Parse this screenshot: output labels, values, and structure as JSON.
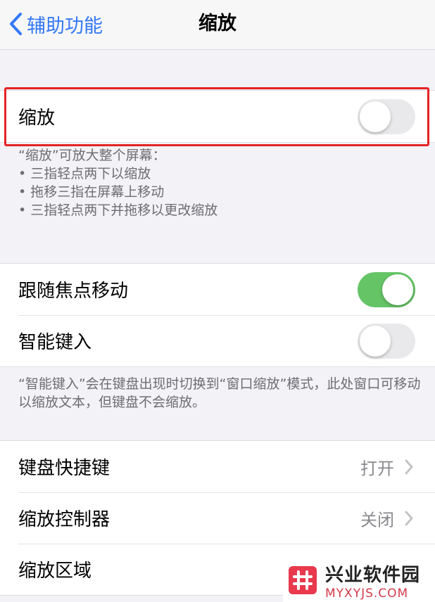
{
  "navbar": {
    "back_label": "辅助功能",
    "title": "缩放"
  },
  "zoom_group": {
    "label": "缩放",
    "toggle": "off"
  },
  "zoom_note": {
    "intro": "“缩放”可放大整个屏幕：",
    "bullets": [
      "三指轻点两下以缩放",
      "拖移三指在屏幕上移动",
      "三指轻点两下并拖移以更改缩放"
    ]
  },
  "options_group": [
    {
      "label": "跟随焦点移动",
      "toggle": "on"
    },
    {
      "label": "智能键入",
      "toggle": "off"
    }
  ],
  "smart_typing_note": "“智能键入”会在键盘出现时切换到“窗口缩放”模式，此处窗口可移动以缩放文本，但键盘不会缩放。",
  "settings_group": [
    {
      "label": "键盘快捷键",
      "value": "打开"
    },
    {
      "label": "缩放控制器",
      "value": "关闭"
    },
    {
      "label": "缩放区域",
      "value": ""
    }
  ],
  "watermark": {
    "name": "兴业软件园",
    "site": "MYXYJS.COM"
  },
  "colors": {
    "accent": "#3478f6",
    "switch_on": "#65c466",
    "highlight": "#e52424"
  }
}
